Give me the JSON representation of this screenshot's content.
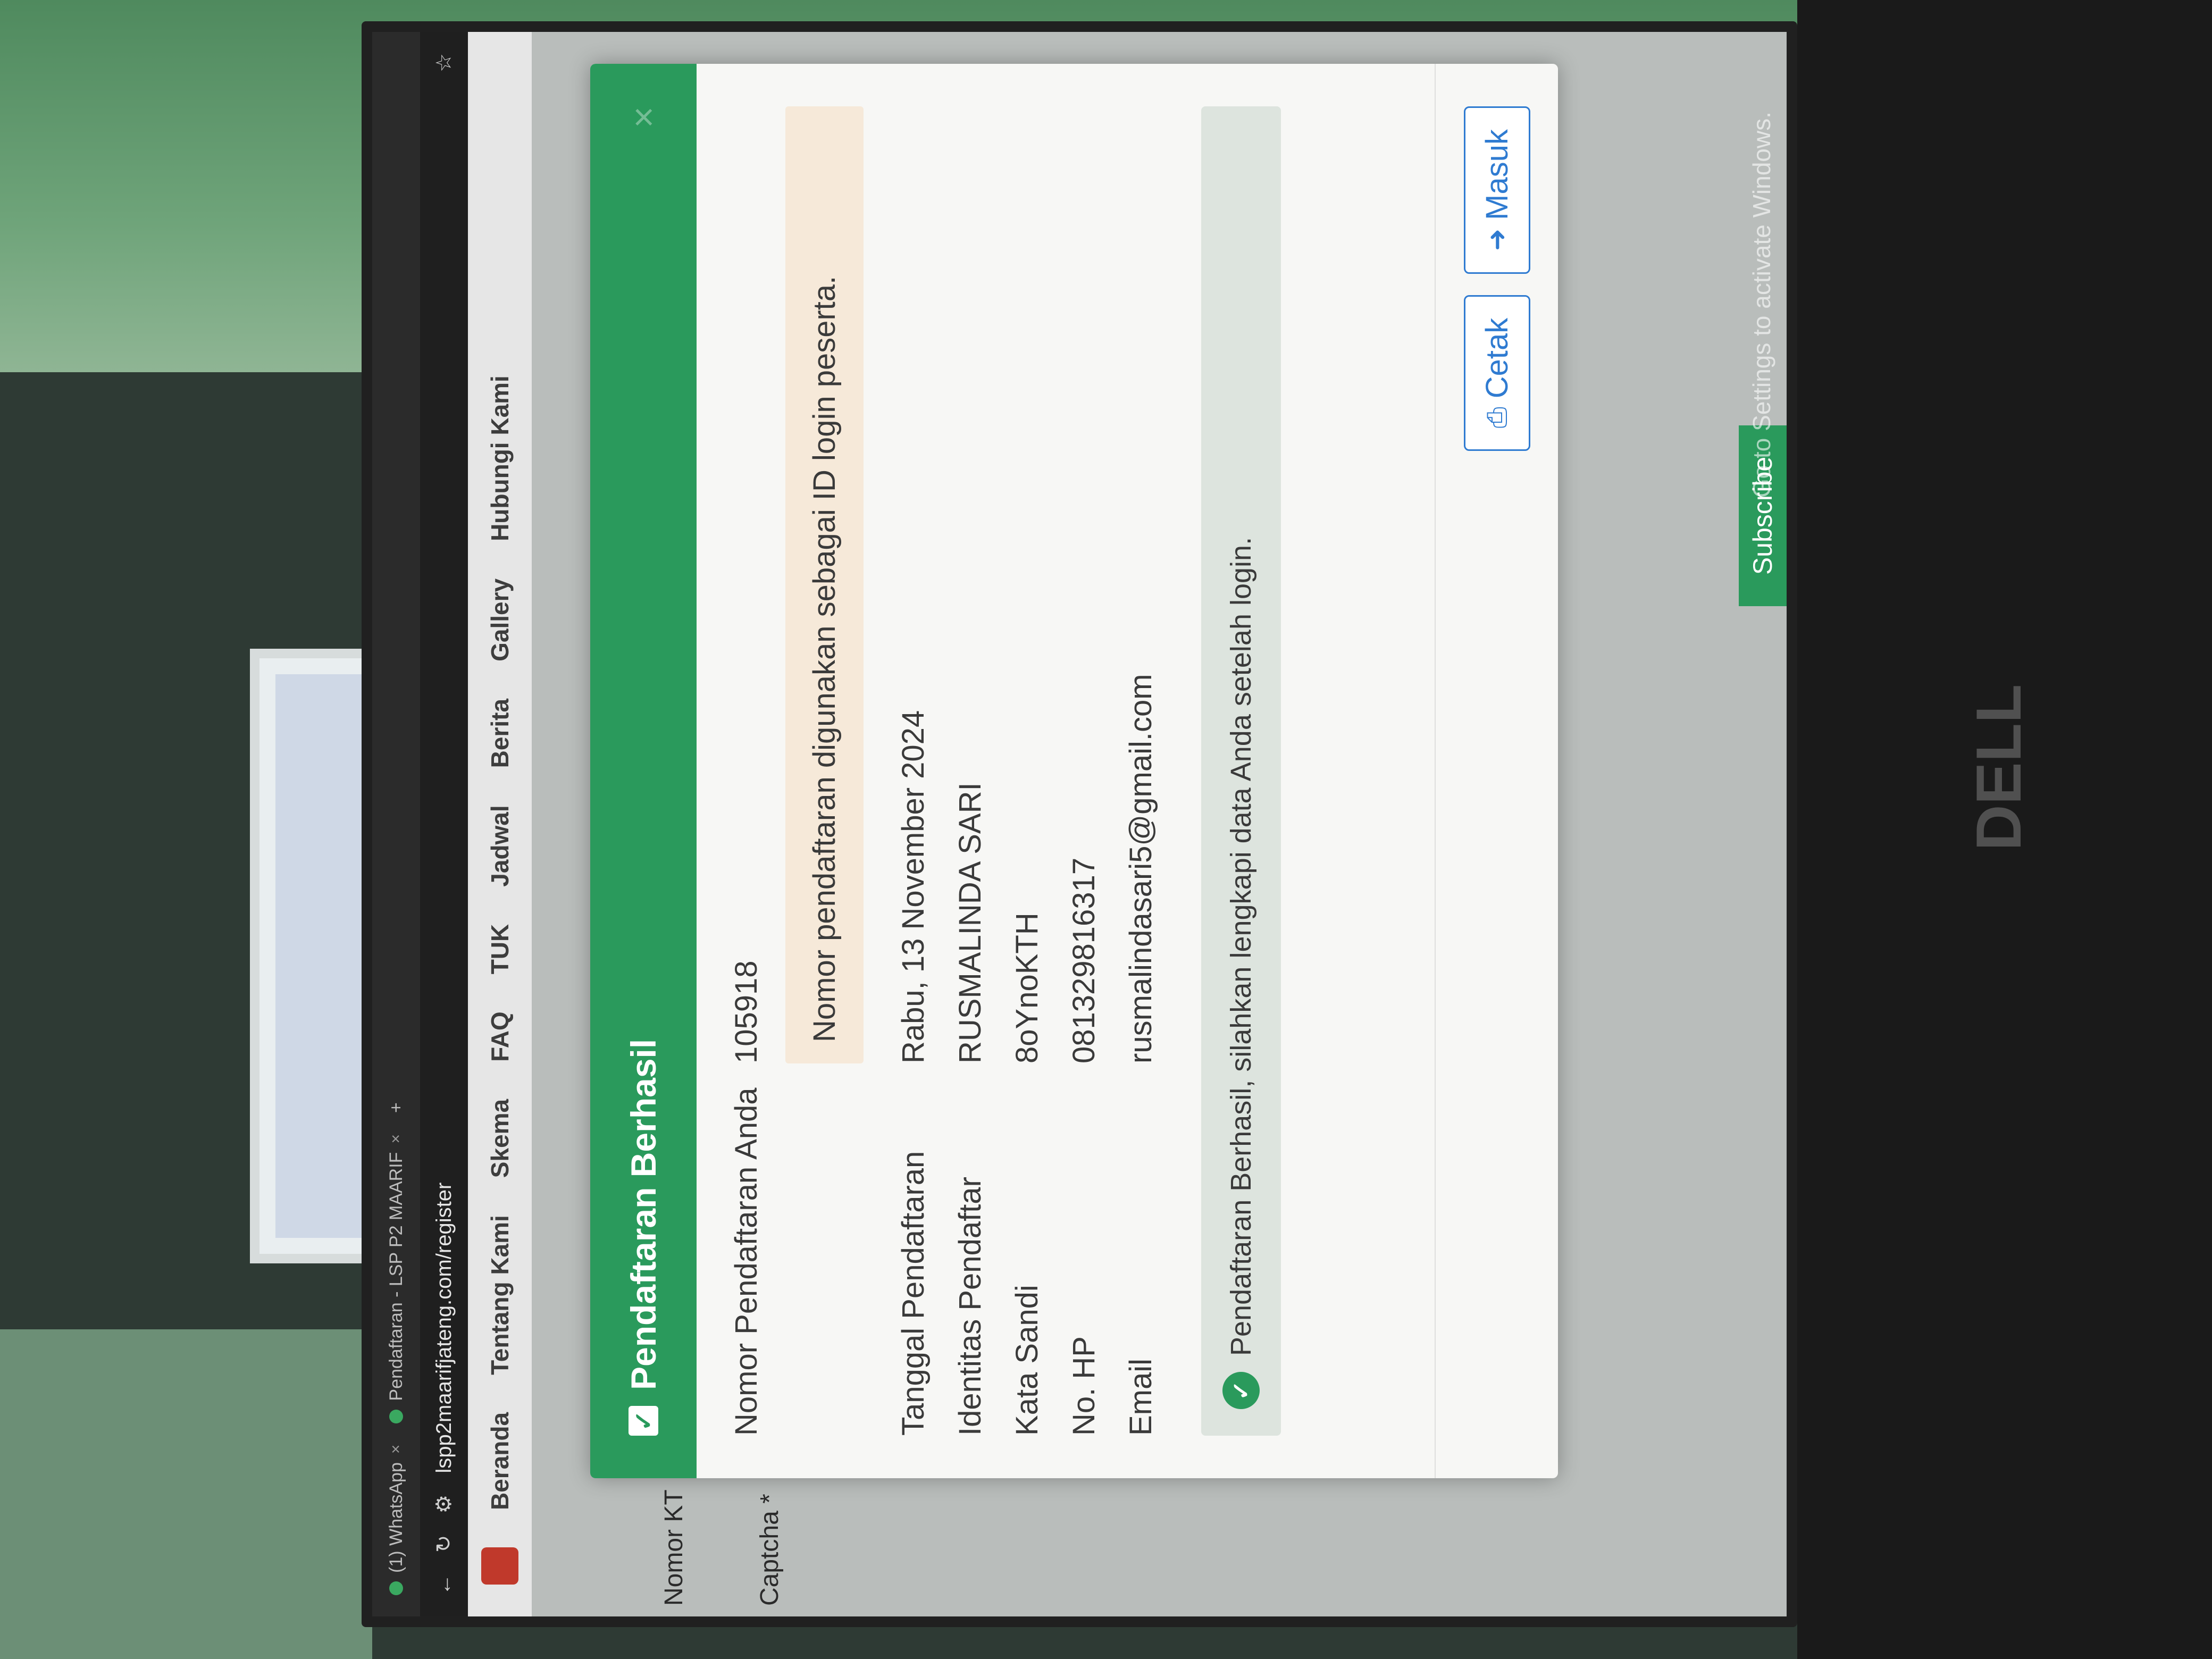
{
  "browser": {
    "tabs": [
      {
        "label": "(1) WhatsApp"
      },
      {
        "label": "Pendaftaran - LSP P2 MAARIF"
      }
    ],
    "url": "lspp2maarifjateng.com/register"
  },
  "site_nav": {
    "items": [
      "Beranda",
      "Tentang Kami",
      "Skema",
      "FAQ",
      "TUK",
      "Jadwal",
      "Berita",
      "Gallery",
      "Hubungi Kami"
    ]
  },
  "page": {
    "label_nomor": "Nomor KT",
    "label_captcha": "Captcha *"
  },
  "modal": {
    "title": "Pendaftaran Berhasil",
    "rows": [
      {
        "key": "Nomor Pendaftaran Anda",
        "value": "105918"
      },
      {
        "key": "Tanggal Pendaftaran",
        "value": "Rabu, 13 November 2024"
      },
      {
        "key": "Identitas Pendaftar",
        "value": "RUSMALINDA SARI"
      },
      {
        "key": "Kata Sandi",
        "value": "8oYnoKTH"
      },
      {
        "key": "No. HP",
        "value": "081329816317"
      },
      {
        "key": "Email",
        "value": "rusmalindasari5@gmail.com"
      }
    ],
    "note": "Nomor pendaftaran digunakan sebagai ID login peserta.",
    "success_text": "Pendaftaran Berhasil, silahkan lengkapi data Anda setelah login.",
    "buttons": {
      "print": "Cetak",
      "login": "Masuk"
    }
  },
  "footer": {
    "subscribe": "Subscribe",
    "activate": "Go to Settings to activate Windows."
  },
  "monitor_brand": "DELL",
  "colors": {
    "accent": "#2a9a5c",
    "button": "#2f7bd1",
    "note_bg": "#f6e9d9"
  }
}
